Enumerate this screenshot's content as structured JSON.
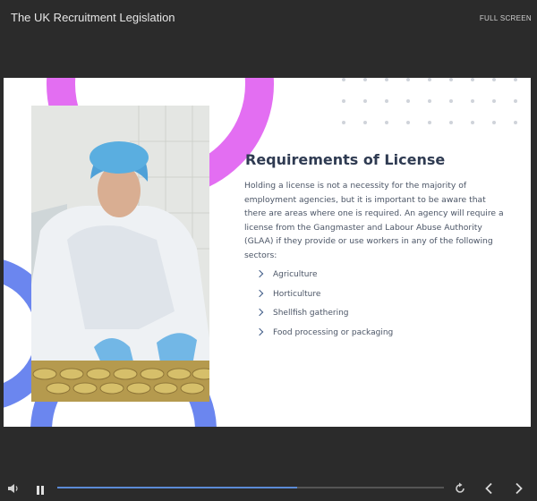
{
  "header": {
    "title": "The UK Recruitment Legislation",
    "fullscreen_label": "FULL SCREEN"
  },
  "slide": {
    "heading": "Requirements of License",
    "body": "Holding a license is not a necessity for the majority of employment agencies, but it is important to be aware that there are areas where one is required. An agency will require a license from the Gangmaster and Labour Abuse Authority (GLAA) if they provide or use workers in any of the following sectors:",
    "sectors": [
      "Agriculture",
      "Horticulture",
      "Shellfish gathering",
      "Food processing or packaging"
    ],
    "photo_icon": "worker-photo",
    "colors": {
      "accent_pink": "#e36ef2",
      "accent_blue": "#6b86ef",
      "heading": "#2f3b52"
    }
  },
  "player": {
    "progress": 0.62,
    "icons": [
      "volume-icon",
      "pause-icon",
      "replay-icon",
      "prev-icon",
      "next-icon"
    ]
  }
}
